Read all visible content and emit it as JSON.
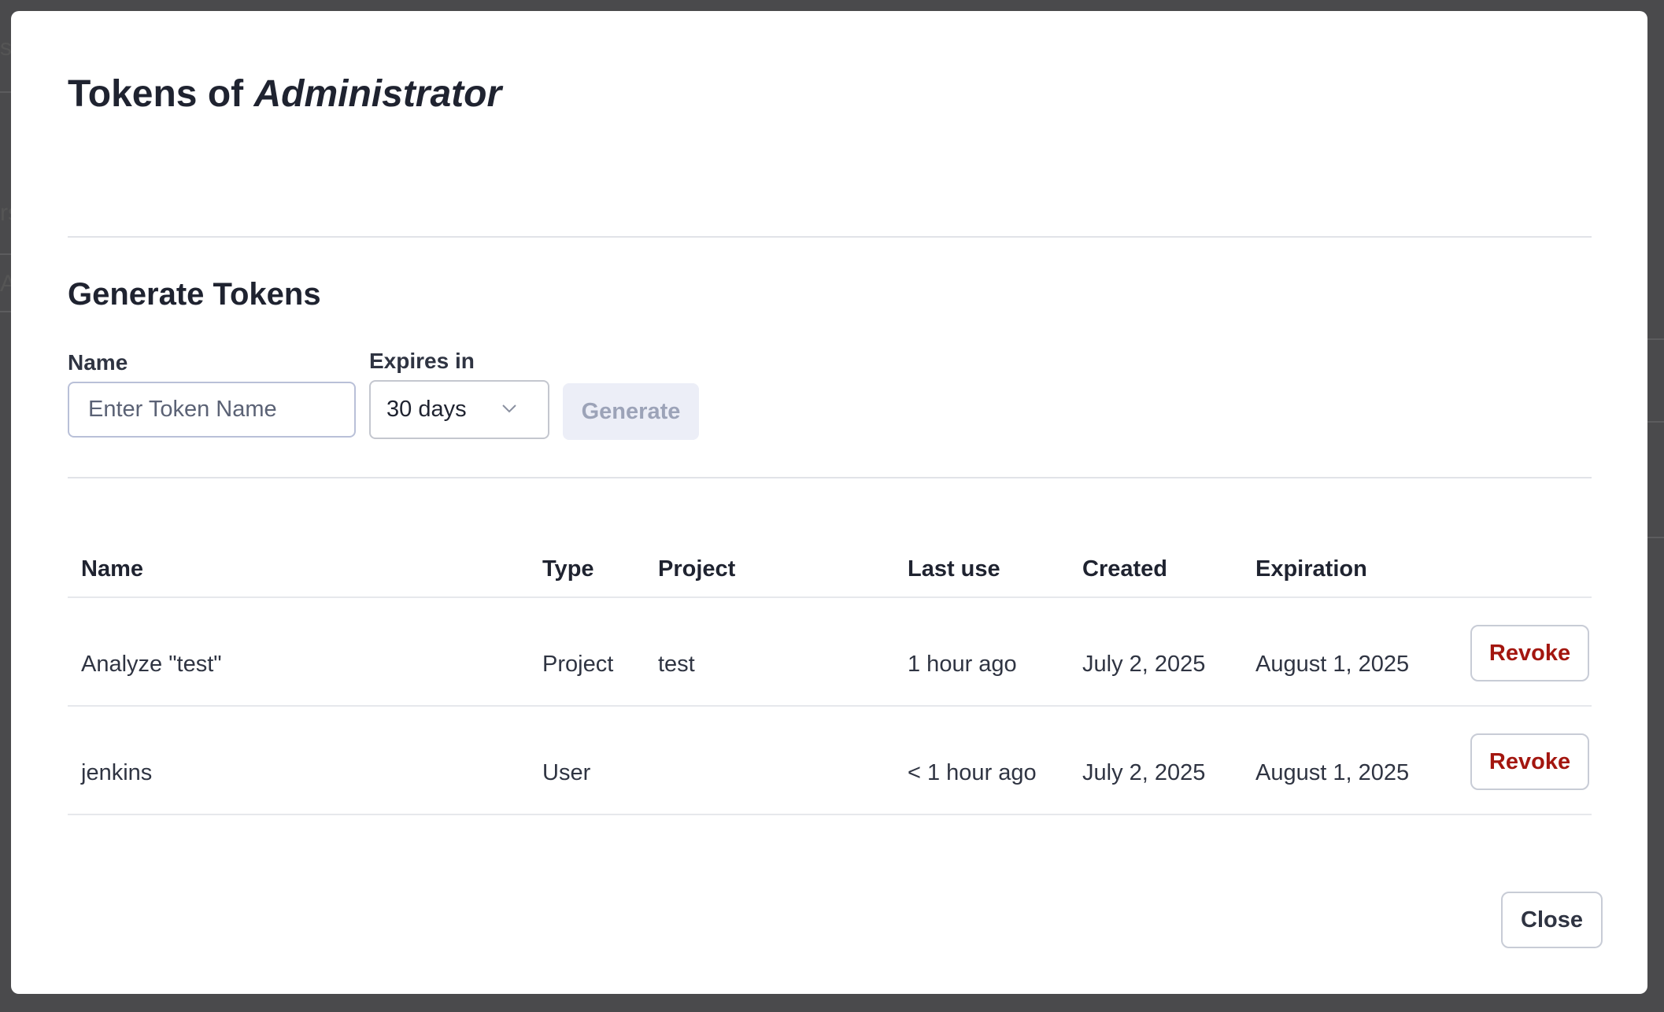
{
  "dialog": {
    "title_prefix": "Tokens of",
    "title_subject": "Administrator",
    "close_label": "Close"
  },
  "generate": {
    "section_title": "Generate Tokens",
    "name_label": "Name",
    "name_placeholder": "Enter Token Name",
    "name_value": "",
    "expires_label": "Expires in",
    "expires_selected": "30 days",
    "generate_label": "Generate"
  },
  "tokens_table": {
    "columns": [
      "Name",
      "Type",
      "Project",
      "Last use",
      "Created",
      "Expiration"
    ],
    "rows": [
      {
        "name": "Analyze \"test\"",
        "type": "Project",
        "project": "test",
        "last_use": "1 hour ago",
        "created": "July 2, 2025",
        "expiration": "August 1, 2025",
        "action_label": "Revoke"
      },
      {
        "name": "jenkins",
        "type": "User",
        "project": "",
        "last_use": "< 1 hour ago",
        "created": "July 2, 2025",
        "expiration": "August 1, 2025",
        "action_label": "Revoke"
      }
    ]
  },
  "background_fragments": [
    "s",
    "rs",
    "A"
  ],
  "colors": {
    "revoke_text": "#a3160f",
    "title_text": "#1f2330",
    "generate_disabled_bg": "#eceef7",
    "overlay": "#4a4a4c"
  },
  "icons": {
    "expires_dropdown": "chevron-down-icon"
  }
}
